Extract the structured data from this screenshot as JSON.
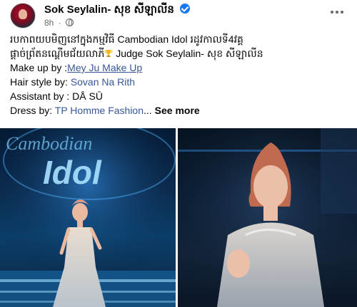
{
  "post": {
    "author": "Sok Seylalin- សុខ សីឡាលីន",
    "time": "8h",
    "dot": "·"
  },
  "body": {
    "line1": "របកាពយបមិញនៅក្នុងកម្មវិធី Cambodian Idol រដូវកាលទី4វគ្គ",
    "line2_text": "ផ្តាច់ព្រ័តនណ្តើមជ័យលាភី",
    "line2_after": " Judge Sok Seylalin- សុខ សីឡាលីន",
    "makeup_label": "Make up by :",
    "makeup_name": "Mey Ju Make Up",
    "hair_label": "Hair style by: ",
    "hair_name": "Sovan Na Rith",
    "assistant_text": "Assistant by : DÅ SŪ",
    "dress_label": "Dress by: ",
    "dress_name": "TP Homme Fashion",
    "ellipsis": "...",
    "see_more": "See more"
  },
  "photos": {
    "stage_sign": "Idol",
    "stage_sign_top": "Cambodian"
  },
  "colors": {
    "link": "#385898",
    "verified": "#1877f2",
    "meta": "#65676b"
  },
  "icons": [
    "verified-badge-icon",
    "globe-icon",
    "more-options-icon",
    "trophy-icon"
  ]
}
